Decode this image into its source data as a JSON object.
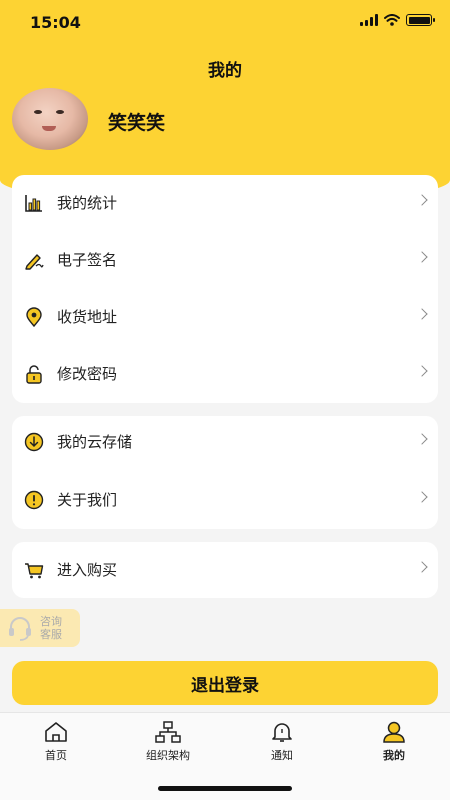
{
  "status_bar": {
    "time": "15:04"
  },
  "header": {
    "title": "我的",
    "username": "笑笑笑"
  },
  "menu_groups": [
    {
      "items": [
        {
          "label": "我的统计",
          "icon": "bar-chart-icon"
        },
        {
          "label": "电子签名",
          "icon": "pen-signature-icon"
        },
        {
          "label": "收货地址",
          "icon": "location-pin-icon"
        },
        {
          "label": "修改密码",
          "icon": "lock-icon"
        }
      ]
    },
    {
      "items": [
        {
          "label": "我的云存储",
          "icon": "cloud-download-icon"
        },
        {
          "label": "关于我们",
          "icon": "info-icon"
        }
      ]
    },
    {
      "items": [
        {
          "label": "进入购买",
          "icon": "shopping-cart-icon"
        }
      ]
    }
  ],
  "service_button": {
    "line1": "咨询",
    "line2": "客服"
  },
  "logout_label": "退出登录",
  "tabbar": [
    {
      "label": "首页",
      "icon": "home-icon"
    },
    {
      "label": "组织架构",
      "icon": "org-chart-icon"
    },
    {
      "label": "通知",
      "icon": "bell-icon"
    },
    {
      "label": "我的",
      "icon": "profile-icon",
      "active": true
    }
  ],
  "colors": {
    "accent": "#fdd333",
    "background": "#f4f4f4",
    "card": "#ffffff"
  }
}
